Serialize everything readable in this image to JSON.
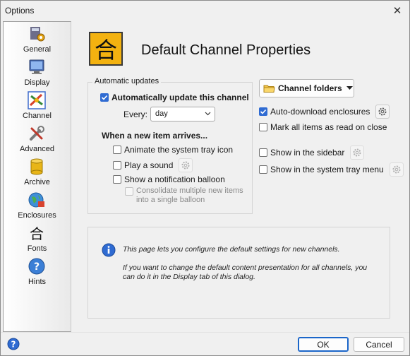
{
  "window": {
    "title": "Options",
    "close_glyph": "✕"
  },
  "sidebar": {
    "items": [
      {
        "label": "General",
        "icon": "general-icon"
      },
      {
        "label": "Display",
        "icon": "monitor-icon"
      },
      {
        "label": "Channel",
        "icon": "channel-icon",
        "selected": true
      },
      {
        "label": "Advanced",
        "icon": "tools-icon"
      },
      {
        "label": "Archive",
        "icon": "database-icon"
      },
      {
        "label": "Enclosures",
        "icon": "globe-icon"
      },
      {
        "label": "Fonts",
        "icon": "font-icon"
      },
      {
        "label": "Hints",
        "icon": "question-icon"
      }
    ]
  },
  "page": {
    "title": "Default Channel Properties",
    "header_glyph": "合"
  },
  "auto_updates": {
    "legend": "Automatic updates",
    "auto_update_label": "Automatically update this channel",
    "auto_update_checked": true,
    "every_label": "Every:",
    "every_value": "day",
    "new_item_heading": "When a new item arrives...",
    "animate_label": "Animate the system tray icon",
    "play_sound_label": "Play a sound",
    "notification_label": "Show a notification balloon",
    "consolidate_line1": "Consolidate multiple new items",
    "consolidate_line2": "into a single balloon"
  },
  "right": {
    "folders_button": "Channel folders",
    "auto_download_label": "Auto-download enclosures",
    "auto_download_checked": true,
    "mark_read_label": "Mark all items as read on close",
    "show_sidebar_label": "Show in the sidebar",
    "show_tray_menu_label": "Show in the system tray menu"
  },
  "info": {
    "line1": "This page lets you configure the default settings for new channels.",
    "line2": "If you want to change the default content presentation for all channels, you",
    "line3": "can do it in the Display tab of this dialog."
  },
  "footer": {
    "ok_label": "OK",
    "cancel_label": "Cancel"
  },
  "colors": {
    "accent": "#2f6bd2",
    "header_icon_bg": "#f3b210",
    "window_bg": "#f0f0f0"
  }
}
